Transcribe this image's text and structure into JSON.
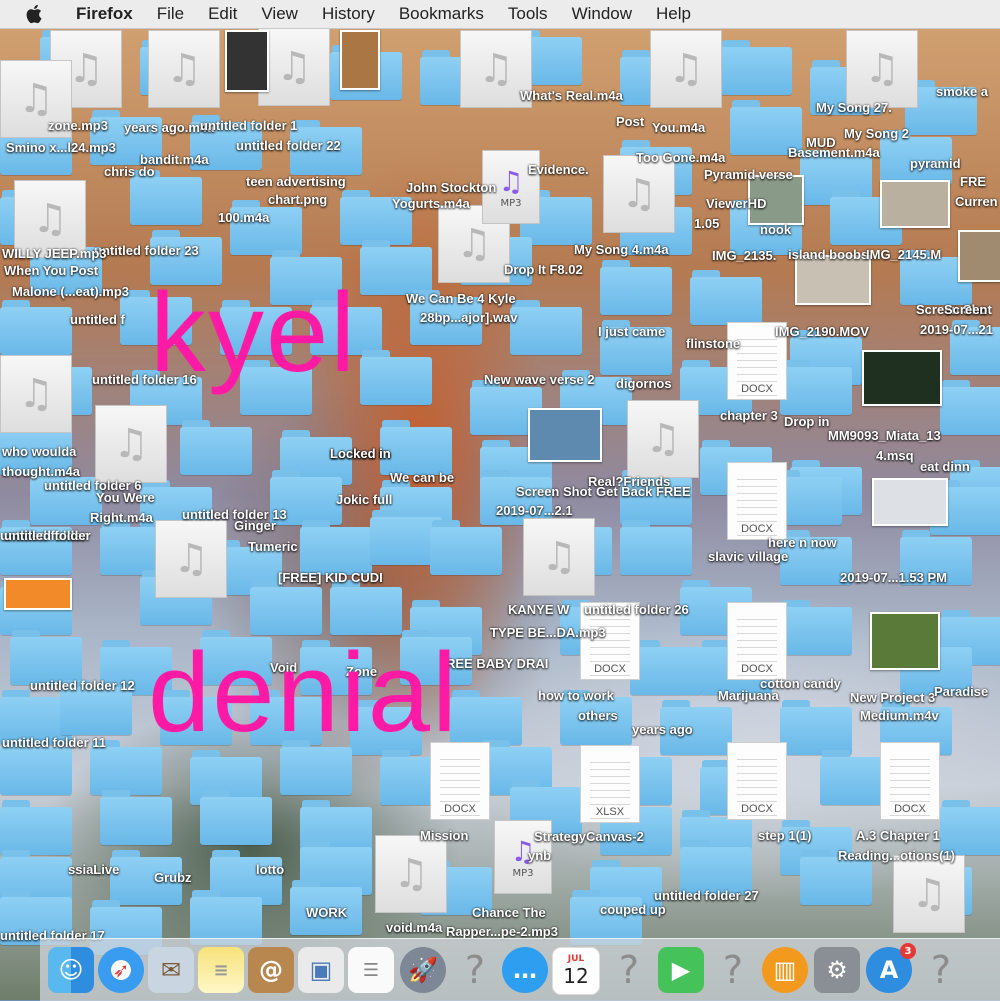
{
  "menubar": {
    "app": "Firefox",
    "items": [
      "File",
      "Edit",
      "View",
      "History",
      "Bookmarks",
      "Tools",
      "Window",
      "Help"
    ]
  },
  "overlay": {
    "word1": "kyel",
    "word2": "denial",
    "color": "#ff1aa6"
  },
  "desktop_labels": [
    "zone.mp3",
    "years ago.m4a",
    "untitled folder 22",
    "What's Real.m4a",
    "My Song 27.",
    "smoke a",
    "Smino x...l24.mp3",
    "chris do",
    "bandit.m4a",
    "teen advertising",
    "John Stockton",
    "Yogurts.m4a",
    "chart.png",
    "100.m4a",
    "untitled folder 23",
    "WILLY JEEP.mp3",
    "When You Post",
    "Malone (...eat).mp3",
    "untitled f",
    "who woulda",
    "thought.m4a",
    "untitled folder 6",
    "You Were",
    "Right.m4a",
    "untitled folder 13",
    "untitled folder",
    "untitled folder 16",
    "untitled folder 12",
    "untitled folder 11",
    "untitled folder 17",
    "Mission",
    "void.m4a",
    "Chance The",
    "Rapper...pe-2.mp3",
    "StrategyCanvas-2",
    "untitled folder 27",
    "couped up",
    "untitled folder 26",
    "KANYE W",
    "TYPE BE...DA.mp3",
    "REE BABY DRAI",
    "how to work",
    "others",
    "years ago",
    "Marijuana",
    "cotton candy",
    "New Project 3",
    "Medium.m4v",
    "Paradise",
    "A.3 Chapter 1",
    "Reading...otions(1)",
    "step 1(1)",
    "Screen Shot",
    "2019-07...1.53 PM",
    "here n now",
    "slavic village",
    "Real?Friends",
    "Screen Shot",
    "2019-07...2.1",
    "Get Back FREE",
    "Locked in",
    "We can be",
    "Jokic full",
    "Ginger",
    "Tumeric",
    "[FREE] KID CUDI",
    "Void",
    "Zone",
    "New wave verse 2",
    "digornos",
    "chapter 3",
    "Drop in",
    "MM9093_Miata_13",
    "4.msq",
    "eat dinn",
    "flinstone",
    "IMG_2190.MOV",
    "I just came",
    "Screen",
    "2019-07...21",
    "IMG_2135.",
    "island boobs",
    "IMG_2145.M",
    "nook",
    "Pyramid verse",
    "pyramid",
    "FRE",
    "Curren",
    "ViewerHD",
    "1.05",
    "We Can Be 4 Kyle",
    "28bp...ajor].wav",
    "My Song 4.m4a",
    "Drop It F8.02",
    "Too Gone.m4a",
    "You.m4a",
    "Post",
    "Basement.m4a",
    "MUD",
    "My Song 2",
    "Grubz",
    "lotto",
    "WORK",
    "ssiaLive",
    "untitled folder",
    "Locked in",
    "Evidence.",
    "ynb",
    "untitled folder 1"
  ],
  "doc_types": [
    "DOCX",
    "DOCX",
    "DOCX",
    "DOCX",
    "DOCX",
    "DOCX",
    "DOCX",
    "XLSX"
  ],
  "mp3_tags": [
    "MP3",
    "MP3"
  ],
  "dock": {
    "calendar_month": "JUL",
    "calendar_day": "12",
    "appstore_badge": "3",
    "unknown_glyph": "?"
  }
}
